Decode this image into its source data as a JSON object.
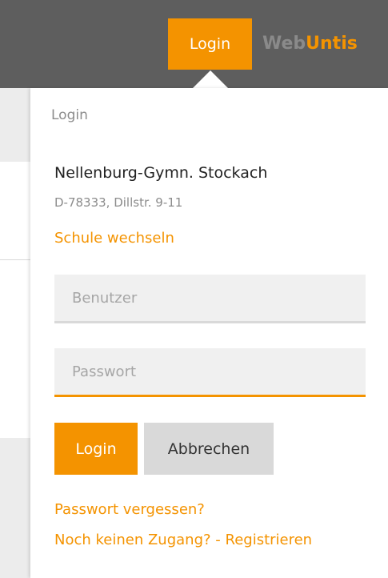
{
  "header": {
    "login_tab_label": "Login",
    "brand_web": "Web",
    "brand_untis": "Untis"
  },
  "panel": {
    "title": "Login",
    "school": {
      "name": "Nellenburg-Gymn. Stockach",
      "address": "D-78333, Dillstr. 9-11"
    },
    "switch_school_link": "Schule wechseln",
    "username": {
      "placeholder": "Benutzer",
      "value": ""
    },
    "password": {
      "placeholder": "Passwort",
      "value": ""
    },
    "buttons": {
      "login": "Login",
      "cancel": "Abbrechen"
    },
    "forgot_password_link": "Passwort vergessen?",
    "register_link": "Noch keinen Zugang? - Registrieren"
  },
  "colors": {
    "accent": "#f49300",
    "header_bg": "#5e5e5e",
    "brand_gray": "#8a8a8a",
    "field_bg": "#f0f0f0",
    "cancel_bg": "#d9d9d9"
  }
}
